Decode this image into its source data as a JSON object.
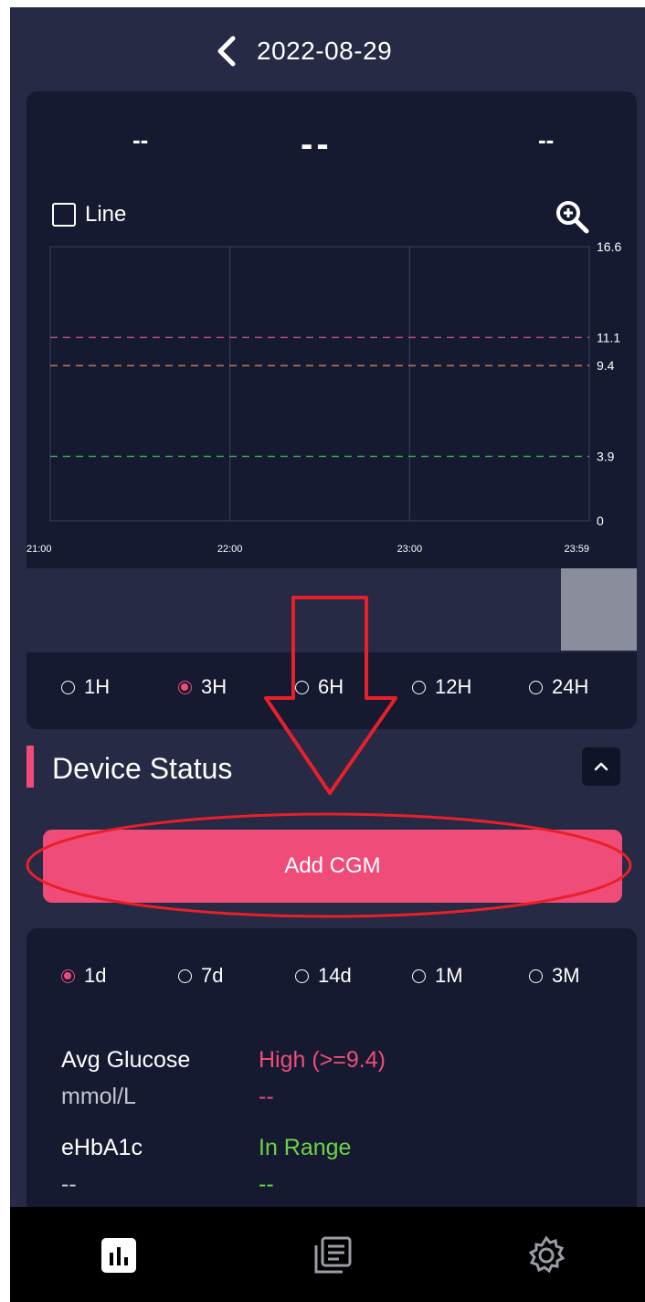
{
  "header": {
    "date": "2022-08-29",
    "back_icon": "chevron-left-icon"
  },
  "summary": {
    "left": "--",
    "center": "--",
    "right": "--"
  },
  "chart_controls": {
    "line_toggle_label": "Line",
    "line_checked": false,
    "zoom_icon": "zoom-in-icon"
  },
  "chart_data": {
    "type": "line",
    "x_ticks": [
      "21:00",
      "22:00",
      "23:00",
      "23:59"
    ],
    "y_ticks": [
      "0",
      "3.9",
      "9.4",
      "11.1",
      "16.6"
    ],
    "ylim": [
      0,
      16.6
    ],
    "thresholds": [
      {
        "value": 11.1,
        "color": "#b0508a"
      },
      {
        "value": 9.4,
        "color": "#c07a5a"
      },
      {
        "value": 3.9,
        "color": "#3fa84a"
      }
    ],
    "series": [],
    "grid": true
  },
  "range_options": [
    {
      "label": "1H",
      "selected": false
    },
    {
      "label": "3H",
      "selected": true
    },
    {
      "label": "6H",
      "selected": false
    },
    {
      "label": "12H",
      "selected": false
    },
    {
      "label": "24H",
      "selected": false
    }
  ],
  "device_status": {
    "title": "Device Status",
    "collapse_icon": "chevron-up-icon"
  },
  "add_cgm_button": {
    "label": "Add CGM"
  },
  "period_options": [
    {
      "label": "1d",
      "selected": true
    },
    {
      "label": "7d",
      "selected": false
    },
    {
      "label": "14d",
      "selected": false
    },
    {
      "label": "1M",
      "selected": false
    },
    {
      "label": "3M",
      "selected": false
    }
  ],
  "stats": {
    "avg_glucose_label": "Avg Glucose",
    "avg_glucose_unit": "mmol/L",
    "high_label": "High  (>=9.4)",
    "high_value": "--",
    "ehba1c_label": "eHbA1c",
    "ehba1c_value": "--",
    "in_range_label": "In Range",
    "in_range_value": "--"
  },
  "tabbar": {
    "items": [
      {
        "icon": "bar-chart-icon",
        "active": true
      },
      {
        "icon": "records-icon",
        "active": false
      },
      {
        "icon": "gear-icon",
        "active": false
      }
    ]
  },
  "colors": {
    "accent": "#f04c7a",
    "background": "#262a45",
    "card": "#151a30",
    "in_range": "#6ed24a",
    "annotation": "#e8202a"
  }
}
